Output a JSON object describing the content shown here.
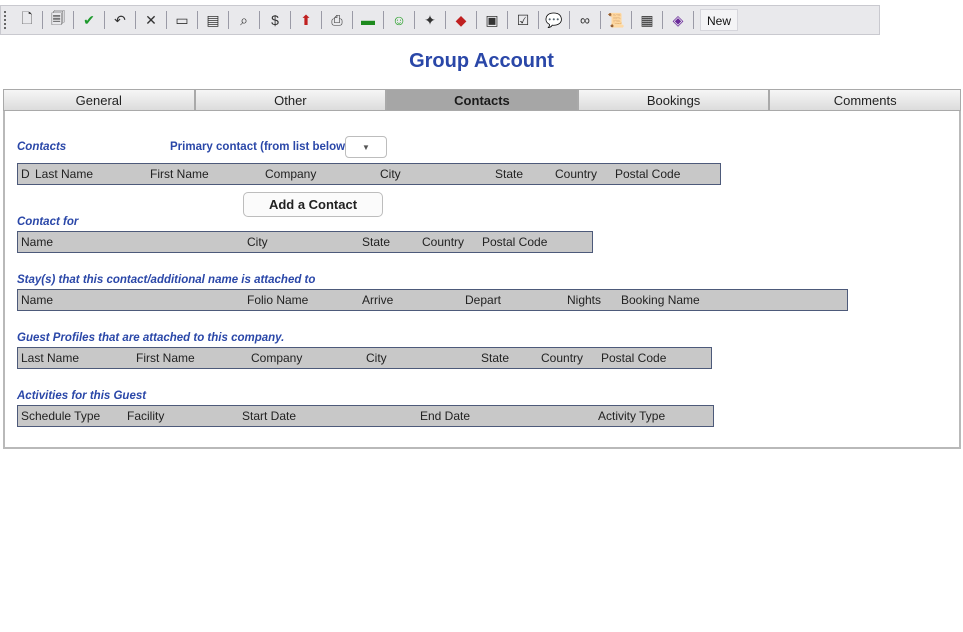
{
  "toolbar": {
    "buttons": [
      {
        "icon": "new-document-icon",
        "glyph": "🗋"
      },
      {
        "icon": "copy-document-icon",
        "glyph": "🗐"
      },
      {
        "icon": "checkmark-icon",
        "glyph": "✔"
      },
      {
        "icon": "undo-icon",
        "glyph": "↶"
      },
      {
        "icon": "delete-icon",
        "glyph": "✕"
      },
      {
        "icon": "id-card-icon",
        "glyph": "▭"
      },
      {
        "icon": "form-icon",
        "glyph": "▤"
      },
      {
        "icon": "search-icon",
        "glyph": "⌕"
      },
      {
        "icon": "money-stack-icon",
        "glyph": "$"
      },
      {
        "icon": "export-icon",
        "glyph": "⬆"
      },
      {
        "icon": "print-icon",
        "glyph": "⎙"
      },
      {
        "icon": "cash-icon",
        "glyph": "▬"
      },
      {
        "icon": "smiley-icon",
        "glyph": "☺"
      },
      {
        "icon": "magic-wand-icon",
        "glyph": "✦"
      },
      {
        "icon": "red-book-icon",
        "glyph": "◆"
      },
      {
        "icon": "book-stack-icon",
        "glyph": "▣"
      },
      {
        "icon": "clipboard-icon",
        "glyph": "☑"
      },
      {
        "icon": "speech-bubble-icon",
        "glyph": "💬"
      },
      {
        "icon": "binoculars-icon",
        "glyph": "∞"
      },
      {
        "icon": "scroll-icon",
        "glyph": "📜"
      },
      {
        "icon": "documents-icon",
        "glyph": "▦"
      },
      {
        "icon": "purple-book-icon",
        "glyph": "◈"
      }
    ],
    "new_label": "New"
  },
  "title": "Group Account",
  "tabs": [
    {
      "label": "General",
      "active": false
    },
    {
      "label": "Other",
      "active": false
    },
    {
      "label": "Contacts",
      "active": true
    },
    {
      "label": "Bookings",
      "active": false
    },
    {
      "label": "Comments",
      "active": false
    }
  ],
  "contacts": {
    "label": "Contacts",
    "primary_label": "Primary contact (from list below)",
    "primary_value": "",
    "columns": [
      "D",
      "Last Name",
      "First Name",
      "Company",
      "City",
      "State",
      "Country",
      "Postal Code"
    ],
    "add_button": "Add a Contact"
  },
  "contact_for": {
    "label": "Contact for",
    "columns": [
      "Name",
      "City",
      "State",
      "Country",
      "Postal Code"
    ]
  },
  "stays": {
    "label": "Stay(s) that this contact/additional name is attached to",
    "columns": [
      "Name",
      "Folio Name",
      "Arrive",
      "Depart",
      "Nights",
      "Booking Name"
    ]
  },
  "guest_profiles": {
    "label": "Guest Profiles that are attached to this company.",
    "columns": [
      "Last Name",
      "First Name",
      "Company",
      "City",
      "State",
      "Country",
      "Postal Code"
    ]
  },
  "activities": {
    "label": "Activities for this Guest",
    "columns": [
      "Schedule Type",
      "Facility",
      "Start Date",
      "End Date",
      "Activity Type"
    ]
  }
}
